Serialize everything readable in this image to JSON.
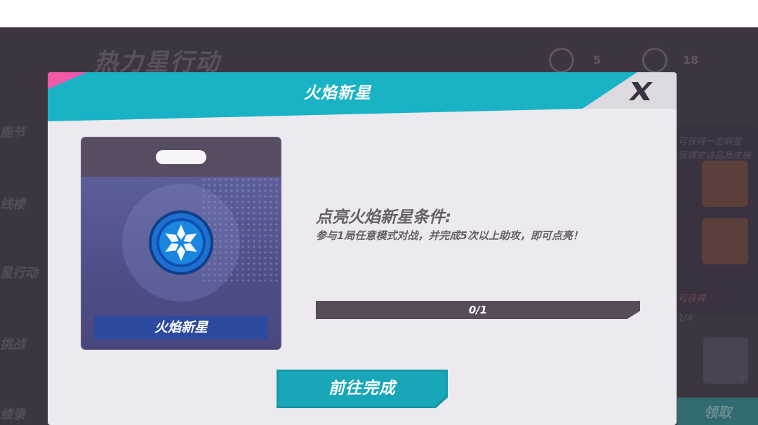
{
  "background": {
    "page_title": "热力星行动",
    "stats": [
      {
        "icon": "medal-icon",
        "value": "5"
      },
      {
        "icon": "target-icon",
        "value": "18"
      }
    ],
    "side_labels": [
      "能节",
      "线楼",
      "星行动",
      "挑战",
      "绩录"
    ],
    "right_texts": [
      "可获得一定联星",
      "获得史诗品质皮肤",
      "可获得",
      "1/4"
    ],
    "claim_label": "领取",
    "card_count": "5"
  },
  "dialog": {
    "title": "火焰新星",
    "close_label": "X",
    "badge": {
      "icon": "snowflake-badge-icon",
      "label": "火焰新星"
    },
    "condition": {
      "title": "点亮火焰新星条件:",
      "description": "参与1局任意模式对战，并完成5次以上助攻，即可点亮！"
    },
    "progress": {
      "current": 0,
      "total": 1,
      "text": "0/1"
    },
    "go_button": "前往完成"
  },
  "colors": {
    "accent_teal": "#1ab3c6",
    "accent_pink": "#f05aa8",
    "dialog_bg": "#eceaee",
    "dark_text": "#66606a",
    "progress_track": "#564c5a",
    "badge_label_blue": "#2c4a9e"
  }
}
